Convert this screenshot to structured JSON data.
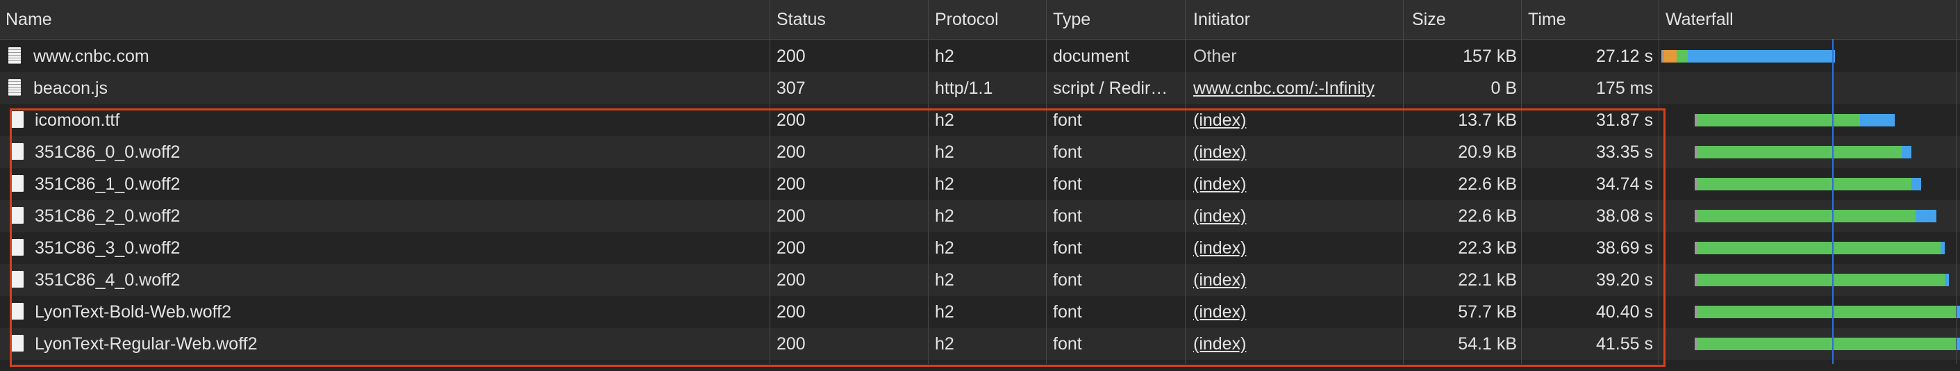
{
  "headers": {
    "name": "Name",
    "status": "Status",
    "protocol": "Protocol",
    "type": "Type",
    "initiator": "Initiator",
    "size": "Size",
    "time": "Time",
    "waterfall": "Waterfall"
  },
  "rows": [
    {
      "name": "www.cnbc.com",
      "status": "200",
      "protocol": "h2",
      "type": "document",
      "initiator": "Other",
      "size": "157 kB",
      "time": "27.12 s",
      "icon": "document-icon"
    },
    {
      "name": "beacon.js",
      "status": "307",
      "protocol": "http/1.1",
      "type": "script / Redir…",
      "initiator": "www.cnbc.com/:-Infinity",
      "size": "0 B",
      "time": "175 ms",
      "icon": "script-icon"
    },
    {
      "name": "icomoon.ttf",
      "status": "200",
      "protocol": "h2",
      "type": "font",
      "initiator": "(index)",
      "size": "13.7 kB",
      "time": "31.87 s",
      "icon": "font-file-icon"
    },
    {
      "name": "351C86_0_0.woff2",
      "status": "200",
      "protocol": "h2",
      "type": "font",
      "initiator": "(index)",
      "size": "20.9 kB",
      "time": "33.35 s",
      "icon": "font-file-icon"
    },
    {
      "name": "351C86_1_0.woff2",
      "status": "200",
      "protocol": "h2",
      "type": "font",
      "initiator": "(index)",
      "size": "22.6 kB",
      "time": "34.74 s",
      "icon": "font-file-icon"
    },
    {
      "name": "351C86_2_0.woff2",
      "status": "200",
      "protocol": "h2",
      "type": "font",
      "initiator": "(index)",
      "size": "22.6 kB",
      "time": "38.08 s",
      "icon": "font-file-icon"
    },
    {
      "name": "351C86_3_0.woff2",
      "status": "200",
      "protocol": "h2",
      "type": "font",
      "initiator": "(index)",
      "size": "22.3 kB",
      "time": "38.69 s",
      "icon": "font-file-icon"
    },
    {
      "name": "351C86_4_0.woff2",
      "status": "200",
      "protocol": "h2",
      "type": "font",
      "initiator": "(index)",
      "size": "22.1 kB",
      "time": "39.20 s",
      "icon": "font-file-icon"
    },
    {
      "name": "LyonText-Bold-Web.woff2",
      "status": "200",
      "protocol": "h2",
      "type": "font",
      "initiator": "(index)",
      "size": "57.7 kB",
      "time": "40.40 s",
      "icon": "font-file-icon"
    },
    {
      "name": "LyonText-Regular-Web.woff2",
      "status": "200",
      "protocol": "h2",
      "type": "font",
      "initiator": "(index)",
      "size": "54.1 kB",
      "time": "41.55 s",
      "icon": "font-file-icon"
    }
  ],
  "colors": {
    "highlight": "#d5411c",
    "waiting": "#5cc45a",
    "download": "#44a3ec",
    "stalled": "#e59a3a",
    "queue": "#9a9a9a",
    "dom_line": "#2f6fd8"
  }
}
